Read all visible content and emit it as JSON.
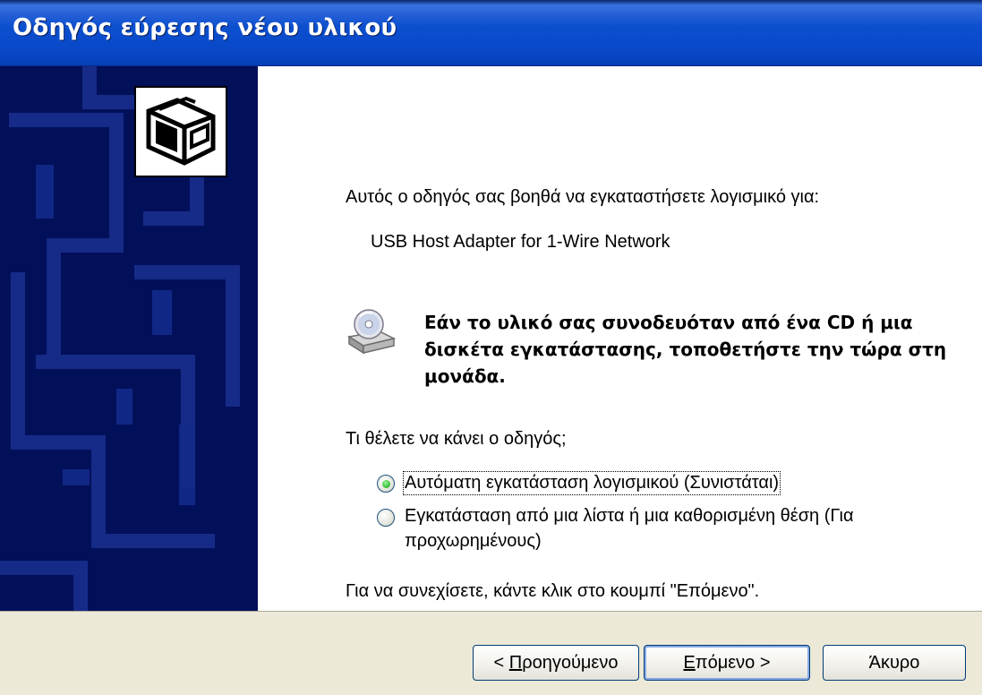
{
  "window": {
    "title": "Οδηγός εύρεσης νέου υλικού"
  },
  "content": {
    "intro": "Αυτός ο οδηγός σας βοηθά να εγκαταστήσετε λογισμικό για:",
    "device_name": "USB Host Adapter for 1-Wire Network",
    "cd_instruction": "Εάν το υλικό σας συνοδευόταν από ένα CD ή μια δισκέτα εγκατάστασης, τοποθετήστε την τώρα στη μονάδα.",
    "question": "Τι θέλετε να κάνει ο οδηγός;",
    "options": [
      {
        "label": "Αυτόματη εγκατάσταση λογισμικού (Συνιστάται)",
        "selected": true
      },
      {
        "label_line1": "Εγκατάσταση από μια λίστα ή μια καθορισμένη θέση (Για",
        "label_line2": "προχωρημένους)",
        "selected": false
      }
    ],
    "continue_hint": "Για να συνεχίσετε, κάντε κλικ στο κουμπί \"Επόμενο\"."
  },
  "buttons": {
    "back_prefix": "< ",
    "back_mnemonic": "Π",
    "back_rest": "ροηγούμενο",
    "next_mnemonic": "Ε",
    "next_rest": "πόμενο >",
    "cancel": "Άκυρο"
  },
  "icons": {
    "hardware": "hardware-card-icon",
    "cd": "cd-drive-icon"
  },
  "colors": {
    "titlebar": "#0847c8",
    "sidebar": "#02105a",
    "dialog_bg": "#ece9d8",
    "radio_selected": "#3bc33b"
  }
}
